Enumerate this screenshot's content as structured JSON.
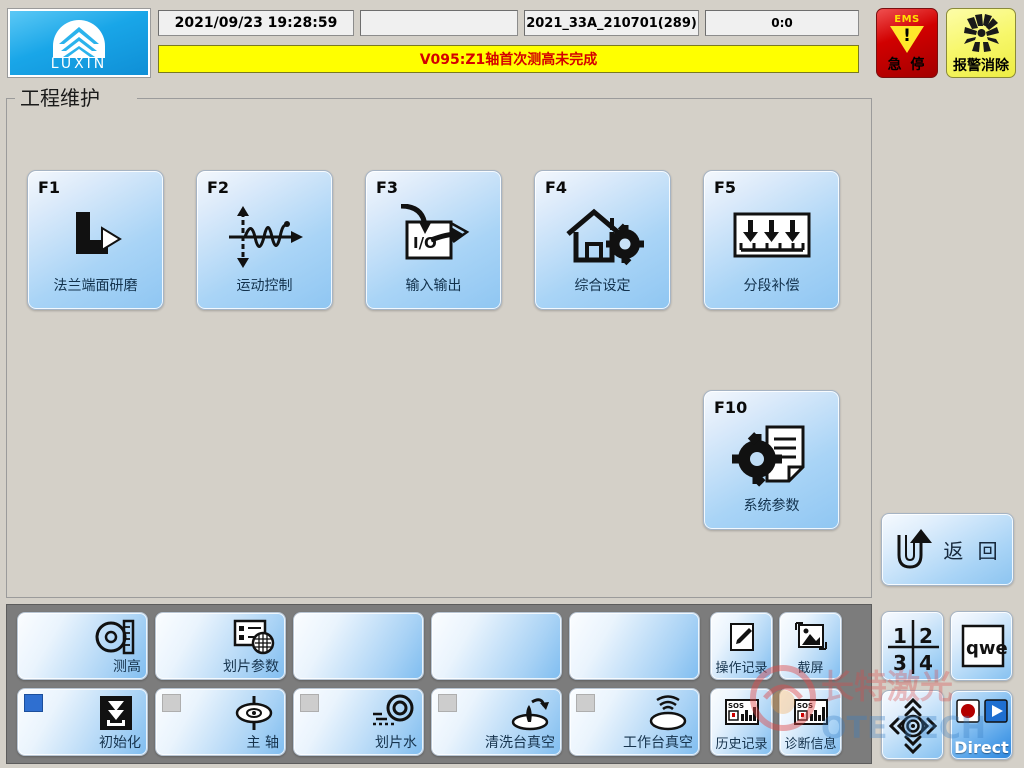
{
  "header": {
    "logo_text": "LUXIN",
    "datetime": "2021/09/23 19:28:59",
    "blank_field": "",
    "recipe": "2021_33A_210701(289)",
    "counter": "0:0",
    "alarm_message": "V095:Z1轴首次测高未完成",
    "alarm_bg_color": "#ffff00",
    "alarm_text_color": "#d40000",
    "ems_button": {
      "top_label": "EMS",
      "label": "急 停",
      "color": "#d10000"
    },
    "alarm_clear_button": {
      "label": "报警消除",
      "color": "#f7f76a"
    }
  },
  "groupbox": {
    "title": "工程维护"
  },
  "function_buttons": [
    {
      "key": "F1",
      "label": "法兰端面研磨",
      "icon": "flange-grinding-icon"
    },
    {
      "key": "F2",
      "label": "运动控制",
      "icon": "motion-control-icon"
    },
    {
      "key": "F3",
      "label": "输入输出",
      "icon": "io-icon"
    },
    {
      "key": "F4",
      "label": "综合设定",
      "icon": "home-gear-icon"
    },
    {
      "key": "F5",
      "label": "分段补偿",
      "icon": "segment-compensation-icon"
    },
    {
      "key": "F10",
      "label": "系统参数",
      "icon": "gear-document-icon"
    }
  ],
  "return_button": {
    "label": "返 回",
    "icon": "u-turn-arrow-icon"
  },
  "toolbar_row1": [
    {
      "label": "测高",
      "icon": "height-gauge-icon",
      "empty": false
    },
    {
      "label": "划片参数",
      "icon": "dicing-params-icon",
      "empty": false
    },
    {
      "label": "",
      "icon": "",
      "empty": true
    },
    {
      "label": "",
      "icon": "",
      "empty": true
    },
    {
      "label": "",
      "icon": "",
      "empty": true
    }
  ],
  "toolbar_row1_small": [
    {
      "label": "操作记录",
      "icon": "pencil-note-icon"
    },
    {
      "label": "截屏",
      "icon": "screenshot-icon"
    }
  ],
  "toolbar_row2": [
    {
      "label": "初始化",
      "icon": "initialize-icon",
      "status": "on"
    },
    {
      "label": "主 轴",
      "icon": "spindle-icon",
      "status": "off"
    },
    {
      "label": "划片水",
      "icon": "dicing-water-icon",
      "status": "off"
    },
    {
      "label": "清洗台真空",
      "icon": "clean-vacuum-icon",
      "status": "off"
    },
    {
      "label": "工作台真空",
      "icon": "worktable-vacuum-icon",
      "status": "off"
    }
  ],
  "toolbar_row2_small": [
    {
      "label": "历史记录",
      "icon": "history-chart-icon"
    },
    {
      "label": "诊断信息",
      "icon": "diagnostic-chart-icon"
    }
  ],
  "keypad": [
    {
      "name": "numeric-keypad",
      "label": "1 2 3 4",
      "icon": "numpad-icon"
    },
    {
      "name": "qwerty-keypad",
      "label": "qwe",
      "icon": "qwe-icon"
    },
    {
      "name": "dpad",
      "label": "",
      "icon": "dpad-icon"
    },
    {
      "name": "direct",
      "label": "Direct",
      "icon": "record-play-icon"
    }
  ],
  "watermark": {
    "line1": "长特激光",
    "line2": "OTE TECH"
  }
}
